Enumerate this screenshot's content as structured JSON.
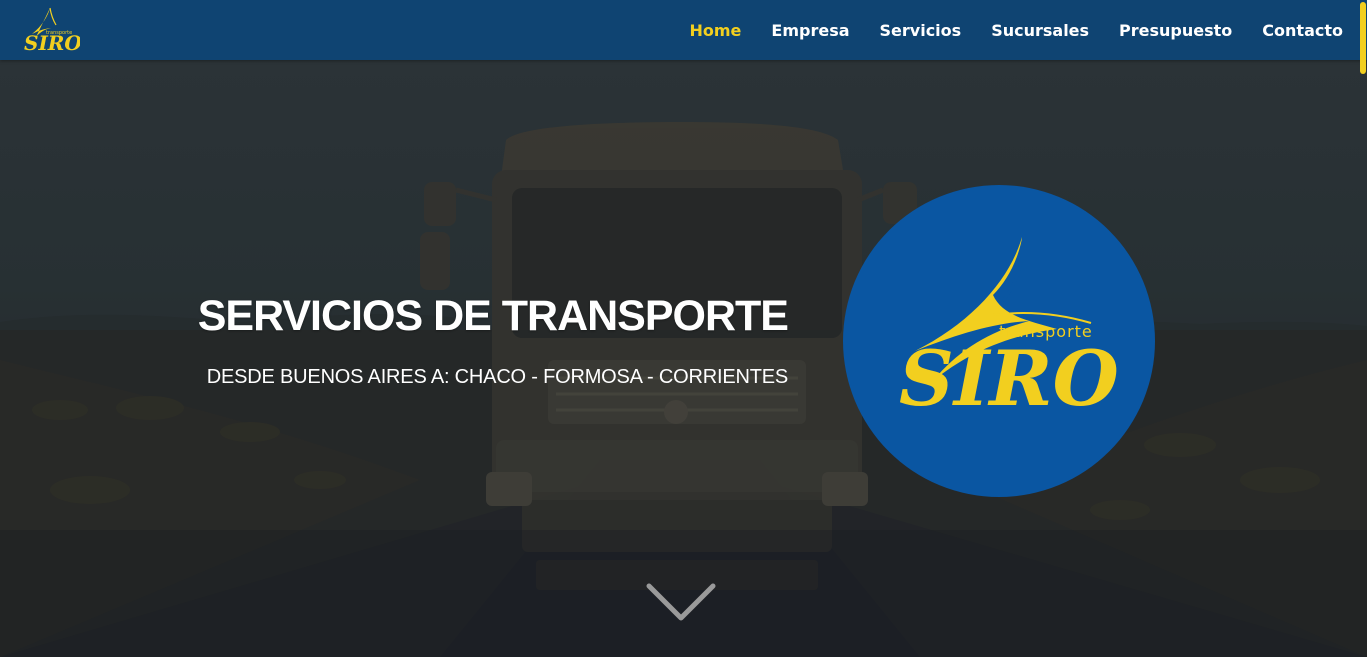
{
  "brand": {
    "logo_word": "SIRO",
    "logo_tagline": "transporte"
  },
  "nav": {
    "items": [
      {
        "label": "Home",
        "active": true
      },
      {
        "label": "Empresa",
        "active": false
      },
      {
        "label": "Servicios",
        "active": false
      },
      {
        "label": "Sucursales",
        "active": false
      },
      {
        "label": "Presupuesto",
        "active": false
      },
      {
        "label": "Contacto",
        "active": false
      }
    ]
  },
  "hero": {
    "title": "SERVICIOS DE TRANSPORTE",
    "subtitle": "DESDE BUENOS AIRES A: CHACO - FORMOSA - CORRIENTES",
    "logo_word": "SIRO",
    "logo_tagline": "transporte",
    "scroll_icon": "chevron-down-icon"
  },
  "colors": {
    "navbar": "#0f4472",
    "accent": "#f2cf1f",
    "logo_circle": "#0a56a2",
    "text": "#ffffff"
  }
}
